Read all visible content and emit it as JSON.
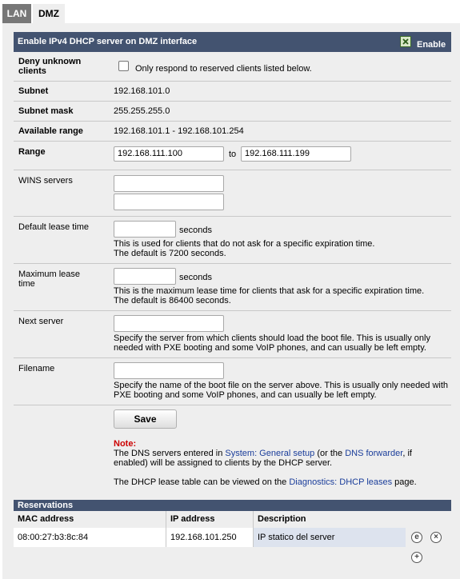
{
  "tabs": [
    {
      "label": "LAN",
      "active": false
    },
    {
      "label": "DMZ",
      "active": true
    }
  ],
  "header": {
    "title": "Enable IPv4 DHCP server on DMZ interface",
    "enable_label": "Enable",
    "enable_checked": true
  },
  "deny_unknown": {
    "label": "Deny unknown clients",
    "checkbox_label": "Only respond to reserved clients listed below."
  },
  "subnet": {
    "label": "Subnet",
    "value": "192.168.101.0"
  },
  "subnet_mask": {
    "label": "Subnet mask",
    "value": "255.255.255.0"
  },
  "available_range": {
    "label": "Available range",
    "value": "192.168.101.1 - 192.168.101.254"
  },
  "range": {
    "label": "Range",
    "from": "192.168.111.100",
    "to_label": "to",
    "to": "192.168.111.199"
  },
  "wins": {
    "label": "WINS servers",
    "server1": "",
    "server2": ""
  },
  "default_lease": {
    "label": "Default lease time",
    "value": "",
    "unit": "seconds",
    "help1": "This is used for clients that do not ask for a specific expiration time.",
    "help2": "The default is 7200 seconds."
  },
  "max_lease": {
    "label": "Maximum lease time",
    "value": "",
    "unit": "seconds",
    "help1": "This is the maximum lease time for clients that ask for a specific expiration time.",
    "help2": "The default is 86400 seconds."
  },
  "next_server": {
    "label": "Next server",
    "value": "",
    "help1": "Specify the server from which clients should load the boot file. This is usually only",
    "help2": "needed with PXE booting and some VoIP phones, and can usually be left empty."
  },
  "filename": {
    "label": "Filename",
    "value": "",
    "help1": "Specify the name of the boot file on the server above. This is usually only needed with",
    "help2": "PXE booting and some VoIP phones, and can usually be left empty."
  },
  "save_label": "Save",
  "note": {
    "title": "Note:",
    "l1_a": "The DNS servers entered in ",
    "l1_link1": "System: General setup",
    "l1_b": " (or the ",
    "l1_link2": "DNS forwarder",
    "l1_c": ", if",
    "l2": "enabled) will be assigned to clients by the DHCP server.",
    "l3_a": "The DHCP lease table can be viewed on the ",
    "l3_link": "Diagnostics: DHCP leases",
    "l3_b": " page."
  },
  "reservations": {
    "title": "Reservations",
    "columns": [
      "MAC address",
      "IP address",
      "Description"
    ],
    "rows": [
      {
        "mac": "08:00:27:b3:8c:84",
        "ip": "192.168.101.250",
        "description": "IP statico del server"
      }
    ]
  }
}
